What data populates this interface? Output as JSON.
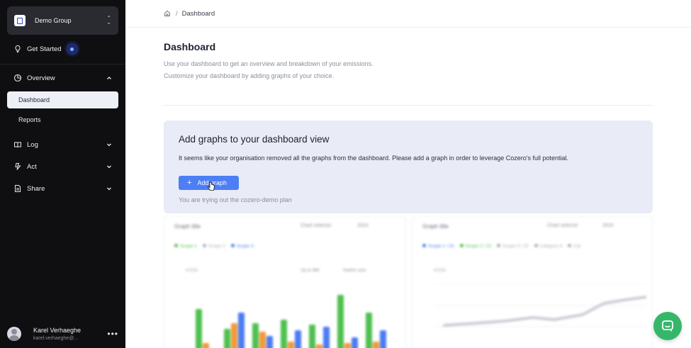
{
  "sidebar": {
    "group": {
      "name": "Demo Group"
    },
    "get_started": "Get Started",
    "items": [
      {
        "label": "Overview",
        "icon": "pie-chart-icon"
      },
      {
        "label": "Log",
        "icon": "book-icon"
      },
      {
        "label": "Act",
        "icon": "bolt-icon"
      },
      {
        "label": "Share",
        "icon": "document-icon"
      }
    ],
    "overview_children": [
      "Dashboard",
      "Reports"
    ],
    "user": {
      "name": "Karel Verhaeghe",
      "email": "karel.verhaeghe@..."
    }
  },
  "breadcrumb": {
    "home_icon": "home-icon",
    "current": "Dashboard"
  },
  "header": {
    "title": "Dashboard",
    "description_line1": "Use your dashboard to get an overview and breakdown of your emissions.",
    "description_line2": "Customize your dashboard by adding graphs of your choice."
  },
  "callout": {
    "title": "Add graphs to your dashboard view",
    "text": "It seems like your organisation removed all the graphs from the dashboard. Please add a graph in order to leverage Cozero's full potential.",
    "button_label": "Add graph",
    "note": "You are trying out the cozero-demo plan"
  },
  "preview_cards": [
    {
      "title": "Graph title",
      "control1": "Chart selector",
      "control2": "2024",
      "legend": [
        "Scope 1",
        "Scope 2",
        "Scope 3"
      ],
      "sub": "tCO2e",
      "opt1": "Up to $M",
      "opt2": "Switch axis"
    },
    {
      "title": "Graph title",
      "control1": "Chart selector",
      "control2": "2024",
      "legend": [
        "Scope 1 / 23",
        "Scope 2 / 23",
        "Scope 3 / 23",
        "Category 4",
        "Cat"
      ],
      "sub": "tCO2e"
    }
  ],
  "colors": {
    "accent": "#4d7ef5",
    "sidebar_bg": "#0f0f12",
    "callout_bg": "#e9ebf6",
    "chat": "#35b76a",
    "green": "#4fc04f",
    "orange": "#f29a38",
    "blue": "#4c7bf2"
  }
}
